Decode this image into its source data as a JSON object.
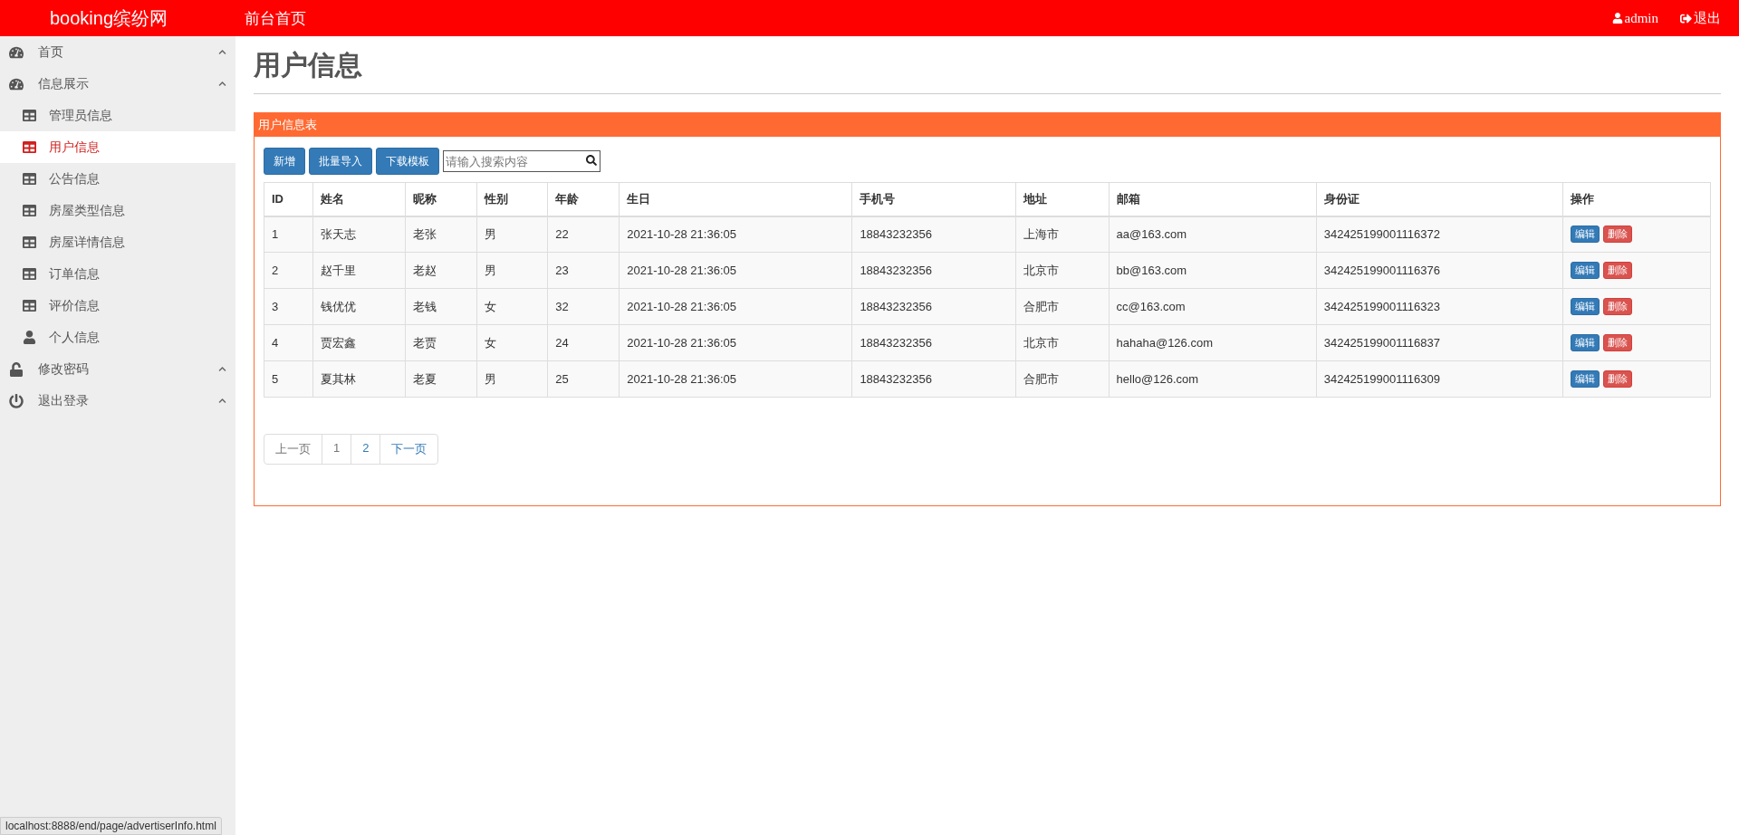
{
  "header": {
    "brand": "booking缤纷网",
    "nav_link": "前台首页",
    "user": "admin",
    "logout": "退出"
  },
  "sidebar": {
    "groups": [
      {
        "label": "首页"
      },
      {
        "label": "信息展示",
        "children": [
          {
            "label": "管理员信息",
            "selected": false
          },
          {
            "label": "用户信息",
            "selected": true
          },
          {
            "label": "公告信息",
            "selected": false
          },
          {
            "label": "房屋类型信息",
            "selected": false
          },
          {
            "label": "房屋详情信息",
            "selected": false
          },
          {
            "label": "订单信息",
            "selected": false
          },
          {
            "label": "评价信息",
            "selected": false
          },
          {
            "label": "个人信息",
            "selected": false
          }
        ]
      },
      {
        "label": "修改密码"
      },
      {
        "label": "退出登录"
      }
    ]
  },
  "page_title": "用户信息",
  "panel": {
    "title": "用户信息表",
    "buttons": [
      "新增",
      "批量导入",
      "下载模板"
    ],
    "search": {
      "placeholder": "请输入搜索内容"
    },
    "table": {
      "columns": [
        "ID",
        "姓名",
        "昵称",
        "性别",
        "年龄",
        "生日",
        "手机号",
        "地址",
        "邮箱",
        "身份证",
        "操作"
      ],
      "rows": [
        {
          "cells": [
            "1",
            "张天志",
            "老张",
            "男",
            "22",
            "2021-10-28 21:36:05",
            "18843232356",
            "上海市",
            "aa@163.com",
            "342425199001116372"
          ],
          "actions": [
            "编辑",
            "删除"
          ]
        },
        {
          "cells": [
            "2",
            "赵千里",
            "老赵",
            "男",
            "23",
            "2021-10-28 21:36:05",
            "18843232356",
            "北京市",
            "bb@163.com",
            "342425199001116376"
          ],
          "actions": [
            "编辑",
            "删除"
          ]
        },
        {
          "cells": [
            "3",
            "钱优优",
            "老钱",
            "女",
            "32",
            "2021-10-28 21:36:05",
            "18843232356",
            "合肥市",
            "cc@163.com",
            "342425199001116323"
          ],
          "actions": [
            "编辑",
            "删除"
          ]
        },
        {
          "cells": [
            "4",
            "贾宏鑫",
            "老贾",
            "女",
            "24",
            "2021-10-28 21:36:05",
            "18843232356",
            "北京市",
            "hahaha@126.com",
            "342425199001116837"
          ],
          "actions": [
            "编辑",
            "删除"
          ]
        },
        {
          "cells": [
            "5",
            "夏其林",
            "老夏",
            "男",
            "25",
            "2021-10-28 21:36:05",
            "18843232356",
            "合肥市",
            "hello@126.com",
            "342425199001116309"
          ],
          "actions": [
            "编辑",
            "删除"
          ]
        }
      ]
    },
    "pagination": [
      {
        "label": "上一页",
        "disabled": true
      },
      {
        "label": "1",
        "disabled": true
      },
      {
        "label": "2",
        "disabled": false
      },
      {
        "label": "下一页",
        "disabled": false
      }
    ]
  },
  "status_url": "localhost:8888/end/page/advertiserInfo.html"
}
